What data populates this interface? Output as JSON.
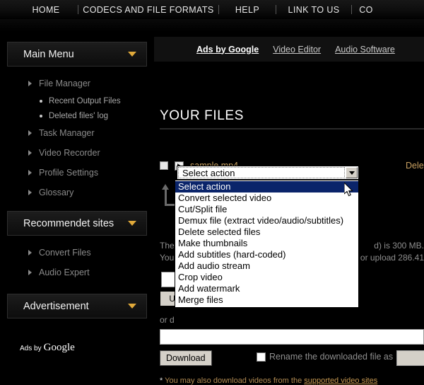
{
  "topnav": {
    "items": [
      {
        "label": "HOME"
      },
      {
        "label": "CODECS AND FILE FORMATS"
      },
      {
        "label": "HELP"
      },
      {
        "label": "LINK TO US"
      },
      {
        "label": "CO"
      }
    ]
  },
  "sidebar": {
    "panels": [
      {
        "title": "Main Menu",
        "caret": "chevron-down-icon",
        "items": [
          {
            "label": "File Manager",
            "subs": [
              "Recent Output Files",
              "Deleted files' log"
            ]
          },
          {
            "label": "Task Manager",
            "subs": []
          },
          {
            "label": "Video Recorder",
            "subs": []
          },
          {
            "label": "Profile Settings",
            "subs": []
          },
          {
            "label": "Glossary",
            "subs": []
          }
        ]
      },
      {
        "title": "Recommendet sites",
        "caret": "chevron-down-icon",
        "items": [
          {
            "label": "Convert Files",
            "subs": []
          },
          {
            "label": "Audio Expert",
            "subs": []
          }
        ]
      },
      {
        "title": "Advertisement",
        "caret": "chevron-down-icon",
        "items": []
      }
    ],
    "ads_by": "Ads by",
    "ads_brand": "Google"
  },
  "adsbar": {
    "links": [
      {
        "label": "Ads by Google",
        "strong": true
      },
      {
        "label": "Video Editor",
        "strong": false
      },
      {
        "label": "Audio Software",
        "strong": false
      }
    ]
  },
  "main": {
    "heading": "YOUR FILES",
    "file_row": {
      "checkbox": "",
      "play_icon": "play-icon",
      "name": "sample.mp4",
      "delete_label": "Delete"
    },
    "select": {
      "value": "Select action",
      "options": [
        "Select action",
        "Convert selected video",
        "Cut/Split file",
        "Demux file (extract video/audio/subtitles)",
        "Delete selected files",
        "Make thumbnails",
        "Add subtitles (hard-coded)",
        "Add audio stream",
        "Crop video",
        "Add watermark",
        "Merge files"
      ],
      "selected_index": 0
    },
    "info_line_1_left": "The",
    "info_line_1_right": "d) is 300 MB.",
    "info_line_2_left": "You",
    "info_line_2_right": "or upload 286.41",
    "upload_button": "Up",
    "or_label": "or d",
    "download_button": "Download",
    "rename_label": "Rename the downloaded file as",
    "rename_value": "",
    "url_value": "",
    "footnote_star": "*",
    "footnote_text": "You may also download videos from the ",
    "footnote_link": "supported video sites"
  },
  "colors": {
    "page_bg": "#000000",
    "accent_gold": "#c8a060",
    "caret_gold": "#e0a93a",
    "select_highlight": "#0a246a",
    "button_face": "#d4d0c8"
  }
}
